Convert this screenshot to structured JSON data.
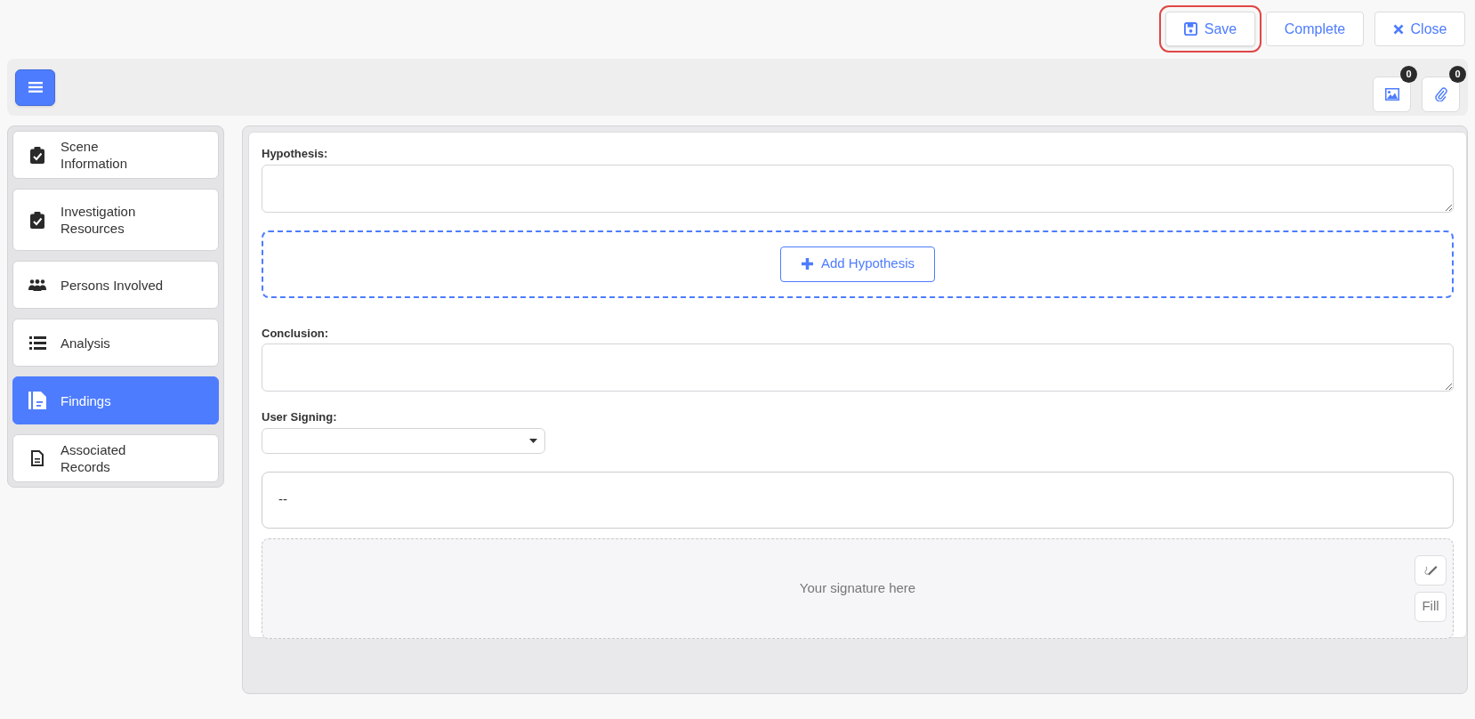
{
  "actions": [
    {
      "kind": "save",
      "label": "Save",
      "highlighted": true
    },
    {
      "kind": "complete",
      "label": "Complete",
      "highlighted": false
    },
    {
      "kind": "close",
      "label": "Close",
      "highlighted": false
    }
  ],
  "toolbar": {
    "counters": [
      {
        "kind": "images",
        "count": "0"
      },
      {
        "kind": "attachments",
        "count": "0"
      }
    ]
  },
  "sidebar": {
    "items": [
      {
        "kind": "clipboard",
        "label": "Scene Information",
        "selected": false
      },
      {
        "kind": "clipboard",
        "label": "Investigation Resources",
        "selected": false
      },
      {
        "kind": "people",
        "label": "Persons Involved",
        "selected": false
      },
      {
        "kind": "list",
        "label": "Analysis",
        "selected": false
      },
      {
        "kind": "findings",
        "label": "Findings",
        "selected": true
      },
      {
        "kind": "file",
        "label": "Associated Records",
        "selected": false
      }
    ]
  },
  "form": {
    "hypothesis_label": "Hypothesis:",
    "add_button": "Add Hypothesis",
    "conclusion_label": "Conclusion:",
    "user_signing_label": "User Signing:",
    "signer_display": "--",
    "signature_placeholder": "Your signature here",
    "fill_button": "Fill"
  }
}
